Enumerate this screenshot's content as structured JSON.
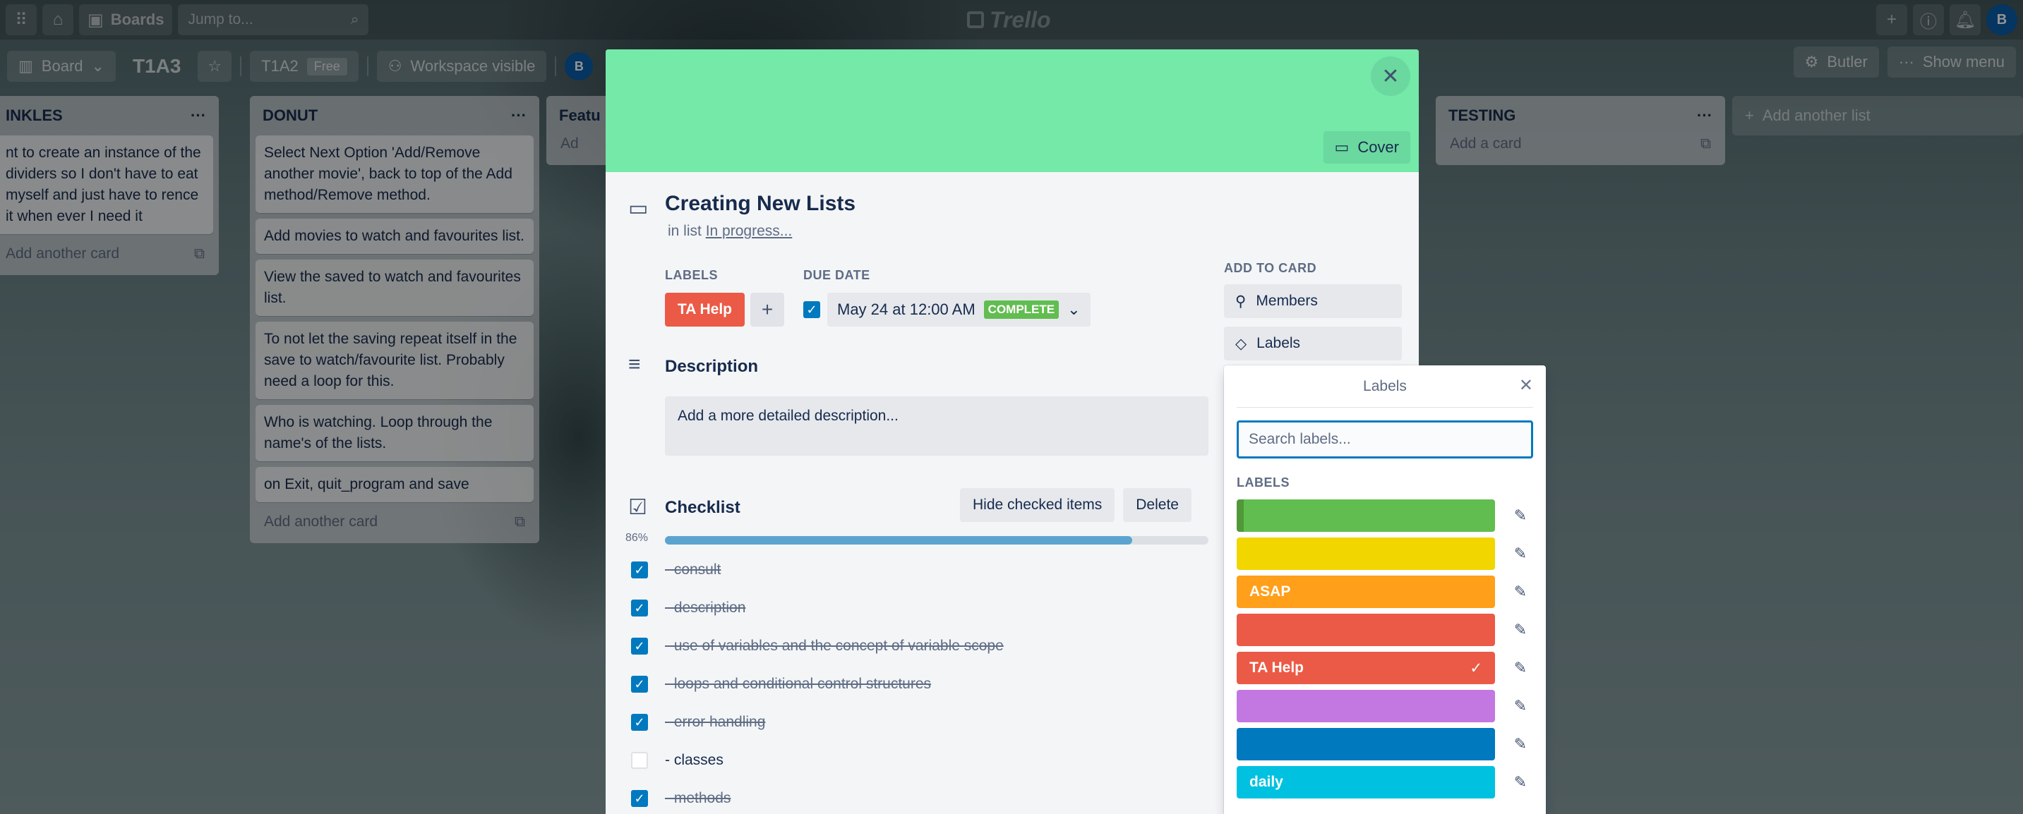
{
  "topnav": {
    "boards_label": "Boards",
    "search_placeholder": "Jump to...",
    "logo_text": "Trello",
    "avatar_initial": "B"
  },
  "boardbar": {
    "view_label": "Board",
    "board_title": "T1A3",
    "workspace_name": "T1A2",
    "plan_badge": "Free",
    "visibility": "Workspace visible",
    "member_initial": "B",
    "butler_label": "Butler",
    "menu_label": "Show menu"
  },
  "lists": [
    {
      "title": "INKLES",
      "cards": [
        "nt to create an instance of the dividers so I don't have to eat myself and just have to rence it when ever I need it"
      ],
      "add_label": "Add another card"
    },
    {
      "title": "DONUT",
      "cards": [
        "Select Next Option 'Add/Remove another movie', back to top of the Add method/Remove method.",
        "Add movies to watch and favourites list.",
        "View the saved to watch and favourites list.",
        "To not let the saving repeat itself in the save to watch/favourite list. Probably need a loop for this.",
        "Who is watching. Loop through the name's of the lists.",
        "on Exit, quit_program and save"
      ],
      "add_label": "Add another card"
    },
    {
      "title": "Featu",
      "cards": [],
      "add_label": "Ad"
    },
    {
      "title": "TESTING",
      "cards": [],
      "add_label": "Add a card"
    }
  ],
  "add_list_label": "Add another list",
  "modal": {
    "cover_label": "Cover",
    "title": "Creating New Lists",
    "in_list_prefix": "in list",
    "in_list_name": "In progress...",
    "labels_heading": "LABELS",
    "card_label": "TA Help",
    "due_heading": "DUE DATE",
    "due_date": "May 24 at 12:00 AM",
    "due_status": "COMPLETE",
    "description_heading": "Description",
    "description_placeholder": "Add a more detailed description...",
    "checklist_heading": "Checklist",
    "hide_checked_label": "Hide checked items",
    "delete_label": "Delete",
    "progress_percent": 86,
    "progress_text": "86%",
    "checklist_items": [
      {
        "text": "- consult",
        "checked": true
      },
      {
        "text": "- description",
        "checked": true
      },
      {
        "text": "- use of variables and the concept of variable scope",
        "checked": true
      },
      {
        "text": "- loops and conditional control structures",
        "checked": true
      },
      {
        "text": "- error handling",
        "checked": true
      },
      {
        "text": "- classes",
        "checked": false
      },
      {
        "text": "- methods",
        "checked": true
      }
    ],
    "add_to_card_heading": "ADD TO CARD",
    "members_label": "Members",
    "labels_button": "Labels"
  },
  "labels_popover": {
    "title": "Labels",
    "search_placeholder": "Search labels...",
    "section_heading": "LABELS",
    "labels": [
      {
        "name": "",
        "color": "#61bd4f",
        "selected": false
      },
      {
        "name": "",
        "color": "#f2d600",
        "selected": false
      },
      {
        "name": "ASAP",
        "color": "#ff9f1a",
        "selected": false
      },
      {
        "name": "",
        "color": "#eb5a46",
        "selected": false
      },
      {
        "name": "TA Help",
        "color": "#eb5a46",
        "selected": true
      },
      {
        "name": "",
        "color": "#c377e0",
        "selected": false
      },
      {
        "name": "",
        "color": "#0079bf",
        "selected": false
      },
      {
        "name": "daily",
        "color": "#00c2e0",
        "selected": false
      }
    ]
  }
}
